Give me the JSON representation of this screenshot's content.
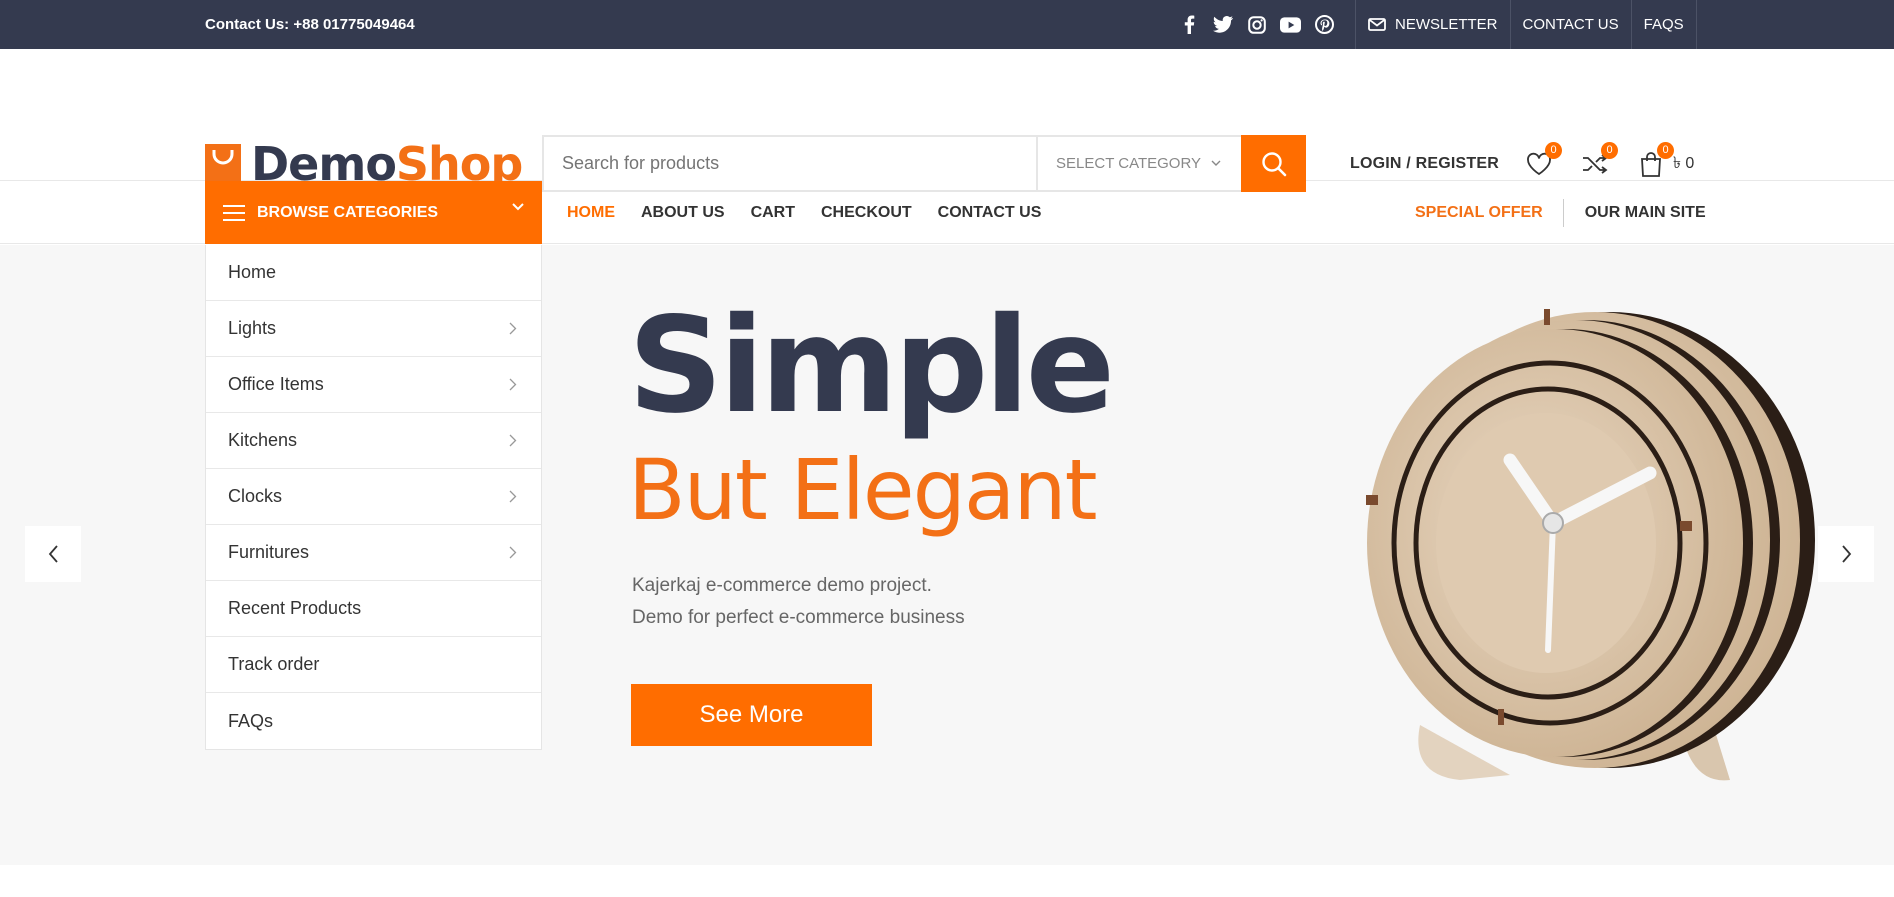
{
  "topbar": {
    "contact": "Contact Us: +88 01775049464",
    "social_icons": [
      "facebook-icon",
      "twitter-icon",
      "instagram-icon",
      "youtube-icon",
      "pinterest-icon"
    ],
    "links": [
      "NEWSLETTER",
      "CONTACT US",
      "FAQS"
    ]
  },
  "header": {
    "logo": {
      "part1": "Demo",
      "part2": "Shop"
    },
    "search": {
      "placeholder": "Search for products",
      "category": "SELECT CATEGORY"
    },
    "login": "LOGIN / REGISTER",
    "wishlist_count": "0",
    "compare_count": "0",
    "cart_count": "0",
    "cart_total": "৳ 0"
  },
  "nav": {
    "browse_label": "BROWSE CATEGORIES",
    "menu": [
      "HOME",
      "ABOUT US",
      "CART",
      "CHECKOUT",
      "CONTACT US"
    ],
    "special_offer": "SPECIAL OFFER",
    "main_site": "OUR MAIN SITE"
  },
  "categories": [
    "Home",
    "Lights",
    "Office Items",
    "Kitchens",
    "Clocks",
    "Furnitures",
    "Recent Products",
    "Track order",
    "FAQs"
  ],
  "hero": {
    "title": "Simple",
    "subtitle": "But Elegant",
    "desc_line1": "Kajerkaj e-commerce demo project.",
    "desc_line2": "Demo for perfect e-commerce business",
    "button": "See More"
  },
  "colors": {
    "accent": "#ff6d00",
    "dark": "#343a4f"
  }
}
